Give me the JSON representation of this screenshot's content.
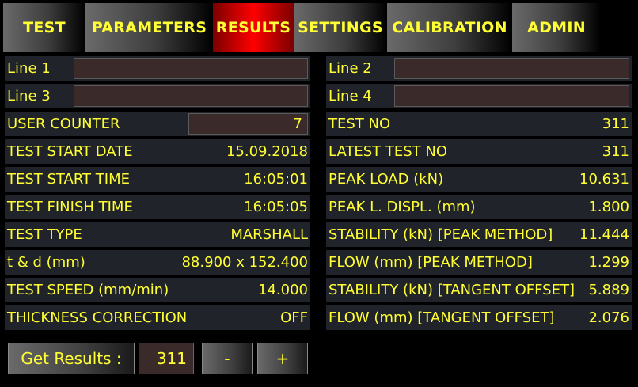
{
  "tabs": [
    "TEST",
    "PARAMETERS",
    "RESULTS",
    "SETTINGS",
    "CALIBRATION",
    "ADMIN"
  ],
  "active_tab": "RESULTS",
  "lines": {
    "line1": {
      "label": "Line 1",
      "value": ""
    },
    "line2": {
      "label": "Line 2",
      "value": ""
    },
    "line3": {
      "label": "Line 3",
      "value": ""
    },
    "line4": {
      "label": "Line 4",
      "value": ""
    }
  },
  "left": [
    {
      "label": "USER COUNTER",
      "value": "7"
    },
    {
      "label": "TEST START DATE",
      "value": "15.09.2018"
    },
    {
      "label": "TEST START TIME",
      "value": "16:05:01"
    },
    {
      "label": "TEST FINISH TIME",
      "value": "16:05:05"
    },
    {
      "label": "TEST TYPE",
      "value": "MARSHALL"
    },
    {
      "label": "t & d (mm)",
      "value": "88.900 x 152.400"
    },
    {
      "label": "TEST SPEED (mm/min)",
      "value": "14.000"
    },
    {
      "label": "THICKNESS CORRECTION",
      "value": "OFF"
    }
  ],
  "right": [
    {
      "label": "TEST NO",
      "value": "311"
    },
    {
      "label": "LATEST TEST NO",
      "value": "311"
    },
    {
      "label": "PEAK LOAD (kN)",
      "value": "10.631"
    },
    {
      "label": "PEAK L. DISPL. (mm)",
      "value": "1.800"
    },
    {
      "label": "STABILITY (kN) [PEAK METHOD]",
      "value": "11.444"
    },
    {
      "label": "FLOW (mm) [PEAK METHOD]",
      "value": "1.299"
    },
    {
      "label": "STABILITY (kN) [TANGENT OFFSET]",
      "value": "5.889"
    },
    {
      "label": "FLOW (mm) [TANGENT OFFSET]",
      "value": "2.076"
    }
  ],
  "get_results": {
    "label": "Get Results :",
    "value": "311",
    "minus": "-",
    "plus": "+"
  }
}
